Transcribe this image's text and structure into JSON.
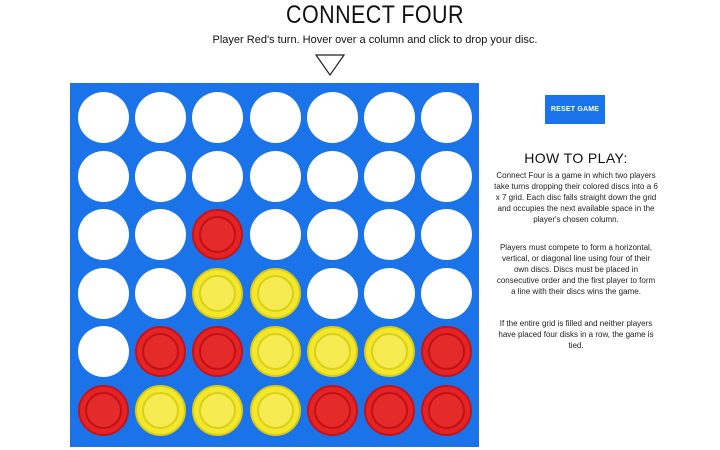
{
  "header": {
    "title": "CONNECT FOUR",
    "status": "Player Red's turn. Hover over a column and click to drop your disc."
  },
  "controls": {
    "reset_label": "RESET GAME"
  },
  "instructions": {
    "heading": "HOW TO PLAY:",
    "paragraphs": [
      "Connect Four is a game in which two players take turns dropping their colored discs into a 6 x 7 grid. Each disc falls straight down the grid and occupies the next available space in the player's chosen column.",
      "Players must compete to form a horizontal, vertical, or diagonal line using four of their own discs. Discs must be placed in consecutive order and the first player to form a line with their discs wins the game.",
      "If the entire grid is filled and neither players have placed four disks in a row, the game is tied."
    ]
  },
  "board": {
    "rows": 6,
    "columns": 7,
    "cells": [
      [
        "empty",
        "empty",
        "empty",
        "empty",
        "empty",
        "empty",
        "empty"
      ],
      [
        "empty",
        "empty",
        "empty",
        "empty",
        "empty",
        "empty",
        "empty"
      ],
      [
        "empty",
        "empty",
        "red",
        "empty",
        "empty",
        "empty",
        "empty"
      ],
      [
        "empty",
        "empty",
        "yellow",
        "yellow",
        "empty",
        "empty",
        "empty"
      ],
      [
        "empty",
        "red",
        "red",
        "yellow",
        "yellow",
        "yellow",
        "red"
      ],
      [
        "red",
        "yellow",
        "yellow",
        "yellow",
        "red",
        "red",
        "red"
      ]
    ],
    "colors": {
      "board": "#1a73e8",
      "red": "#e62323",
      "yellow": "#f5e82c",
      "empty": "#ffffff"
    }
  },
  "icons": {
    "drop_pointer": "down-triangle-icon"
  }
}
